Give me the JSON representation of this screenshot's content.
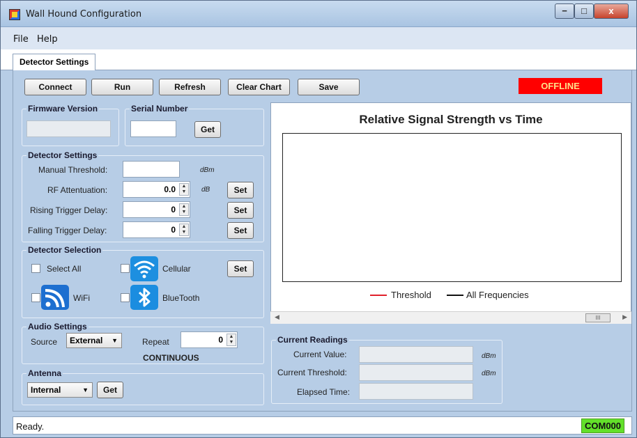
{
  "window": {
    "title": "Wall Hound Configuration",
    "minimize": "−",
    "maximize": "□",
    "close": "x"
  },
  "menu": {
    "file": "File",
    "help": "Help"
  },
  "tabs": {
    "detector_settings": "Detector Settings"
  },
  "toolbar": {
    "connect": "Connect",
    "run": "Run",
    "refresh": "Refresh",
    "clear_chart": "Clear Chart",
    "save": "Save",
    "status_badge": "OFFLINE"
  },
  "firmware": {
    "title": "Firmware Version",
    "value": ""
  },
  "serial": {
    "title": "Serial Number",
    "value": "",
    "get": "Get"
  },
  "detector_settings": {
    "title": "Detector Settings",
    "manual_threshold": {
      "label": "Manual Threshold:",
      "value": "",
      "unit": "dBm"
    },
    "rf_attenuation": {
      "label": "RF Attentuation:",
      "value": "0.0",
      "unit": "dB",
      "set": "Set"
    },
    "rising_delay": {
      "label": "Rising Trigger Delay:",
      "value": "0",
      "set": "Set"
    },
    "falling_delay": {
      "label": "Falling Trigger Delay:",
      "value": "0",
      "set": "Set"
    }
  },
  "detector_selection": {
    "title": "Detector Selection",
    "select_all": "Select All",
    "cellular": "Cellular",
    "wifi": "WiFi",
    "bluetooth": "BlueTooth",
    "set": "Set"
  },
  "audio": {
    "title": "Audio Settings",
    "source_label": "Source",
    "source_value": "External",
    "repeat_label": "Repeat",
    "repeat_value": "0",
    "mode": "CONTINUOUS"
  },
  "antenna": {
    "title": "Antenna",
    "value": "Internal",
    "get": "Get"
  },
  "chart": {
    "title": "Relative Signal Strength vs Time",
    "legend_threshold": "Threshold",
    "legend_all": "All Frequencies",
    "threshold_color": "#e0202a",
    "all_color": "#111111",
    "scroll_thumb": "III"
  },
  "chart_data": {
    "type": "line",
    "title": "Relative Signal Strength vs Time",
    "series": [
      {
        "name": "Threshold",
        "values": []
      },
      {
        "name": "All Frequencies",
        "values": []
      }
    ],
    "legend": "bottom"
  },
  "readings": {
    "title": "Current Readings",
    "current_value": {
      "label": "Current Value:",
      "value": "",
      "unit": "dBm"
    },
    "current_threshold": {
      "label": "Current Threshold:",
      "value": "",
      "unit": "dBm"
    },
    "elapsed_time": {
      "label": "Elapsed Time:",
      "value": ""
    }
  },
  "status": {
    "text": "Ready.",
    "port": "COM000"
  }
}
